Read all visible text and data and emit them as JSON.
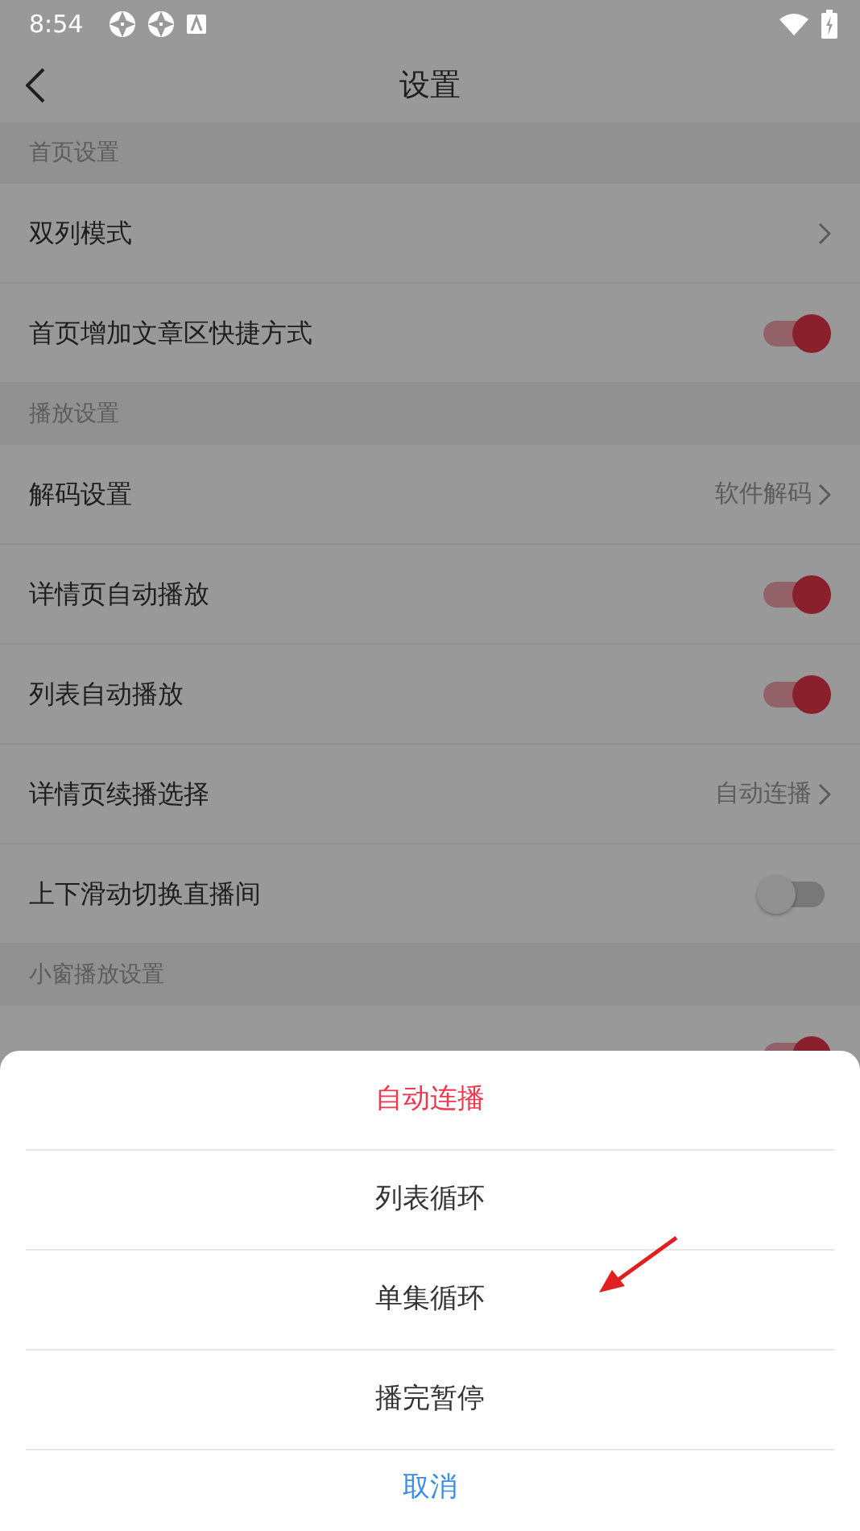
{
  "status_bar": {
    "time": "8:54"
  },
  "header": {
    "title": "设置"
  },
  "sections": [
    {
      "title": "首页设置",
      "rows": [
        {
          "kind": "link",
          "label": "双列模式"
        },
        {
          "kind": "toggle",
          "label": "首页增加文章区快捷方式",
          "on": true
        }
      ]
    },
    {
      "title": "播放设置",
      "rows": [
        {
          "kind": "link",
          "label": "解码设置",
          "value": "软件解码"
        },
        {
          "kind": "toggle",
          "label": "详情页自动播放",
          "on": true
        },
        {
          "kind": "toggle",
          "label": "列表自动播放",
          "on": true
        },
        {
          "kind": "link",
          "label": "详情页续播选择",
          "value": "自动连播"
        },
        {
          "kind": "toggle",
          "label": "上下滑动切换直播间",
          "on": false
        }
      ]
    },
    {
      "title": "小窗播放设置",
      "rows": [
        {
          "kind": "toggle",
          "on": true
        }
      ]
    }
  ],
  "action_sheet": {
    "options": [
      {
        "label": "自动连播",
        "selected": true
      },
      {
        "label": "列表循环",
        "selected": false
      },
      {
        "label": "单集循环",
        "selected": false
      },
      {
        "label": "播完暂停",
        "selected": false
      }
    ],
    "cancel": "取消"
  }
}
